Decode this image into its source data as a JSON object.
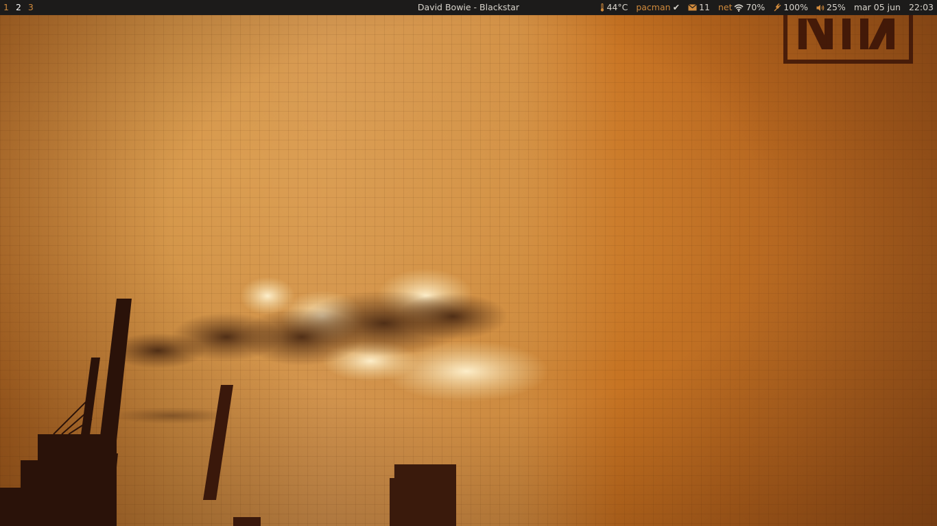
{
  "workspaces": [
    {
      "label": "1",
      "state": "inactive"
    },
    {
      "label": "2",
      "state": "current"
    },
    {
      "label": "3",
      "state": "occupied"
    }
  ],
  "window_title": "David Bowie - Blackstar",
  "status": {
    "temperature": {
      "icon": "thermometer-icon",
      "value": "44°C"
    },
    "pacman": {
      "label": "pacman",
      "mark": "✔"
    },
    "mail": {
      "icon": "mail-icon",
      "count": "11"
    },
    "network": {
      "label": "net",
      "icon": "wifi-icon",
      "value": "70%"
    },
    "battery": {
      "icon": "battery-charging-icon",
      "value": "100%"
    },
    "volume": {
      "icon": "speaker-icon",
      "value": "25%"
    },
    "date": "mar 05 jun",
    "time": "22:03"
  },
  "wallpaper": {
    "logo_text": "NIN",
    "subject": "industrial-smokestacks"
  },
  "colors": {
    "bar_bg": "#1c1b1a",
    "bar_text": "#d8d4cc",
    "accent": "#d08a3c",
    "current_workspace": "#ffffff"
  }
}
